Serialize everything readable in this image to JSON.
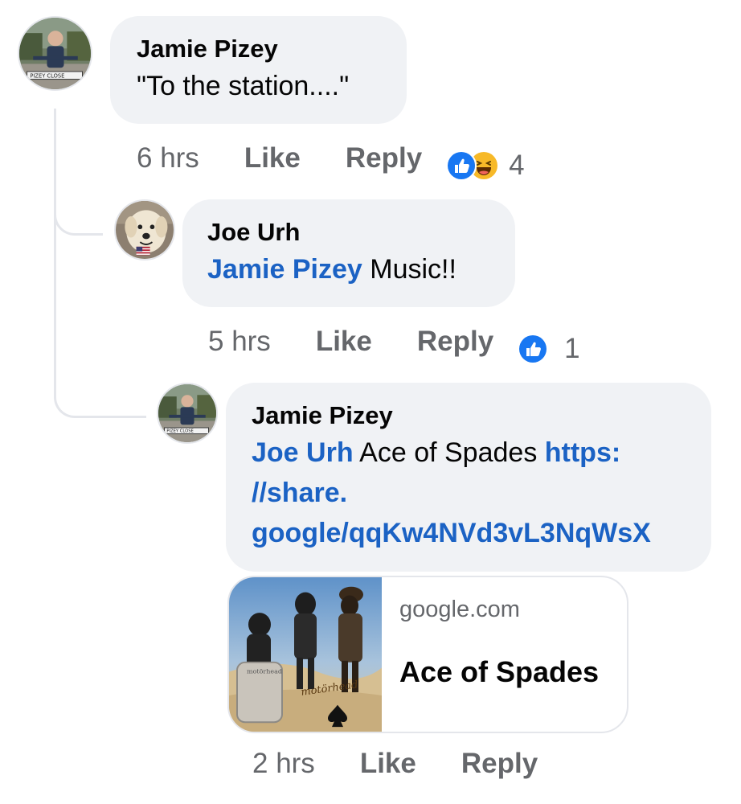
{
  "colors": {
    "bubble_bg": "#f0f2f5",
    "link": "#1b62c4",
    "meta_text": "#65676b",
    "like_blue": "#1877f2",
    "haha_yellow": "#f7b928",
    "thread_line": "#e4e6eb"
  },
  "comments": [
    {
      "author": "Jamie Pizey",
      "text": "\"To the station....\"",
      "time": "6 hrs",
      "like_label": "Like",
      "reply_label": "Reply",
      "reactions": [
        "like-icon",
        "haha-icon"
      ],
      "reaction_count": "4"
    },
    {
      "author": "Joe Urh",
      "mention": "Jamie Pizey",
      "text": " Music!!",
      "time": "5 hrs",
      "like_label": "Like",
      "reply_label": "Reply",
      "reactions": [
        "like-icon"
      ],
      "reaction_count": "1"
    },
    {
      "author": "Jamie Pizey",
      "mention": "Joe Urh",
      "text": " Ace of Spades ",
      "link_line1": "https:",
      "link_line2": "//share.",
      "link_line3": "google/qqKw4NVd3vL3NqWsX",
      "preview": {
        "domain": "google.com",
        "title": "Ace of Spades",
        "image": "album-cover"
      },
      "time": "2 hrs",
      "like_label": "Like",
      "reply_label": "Reply"
    }
  ]
}
